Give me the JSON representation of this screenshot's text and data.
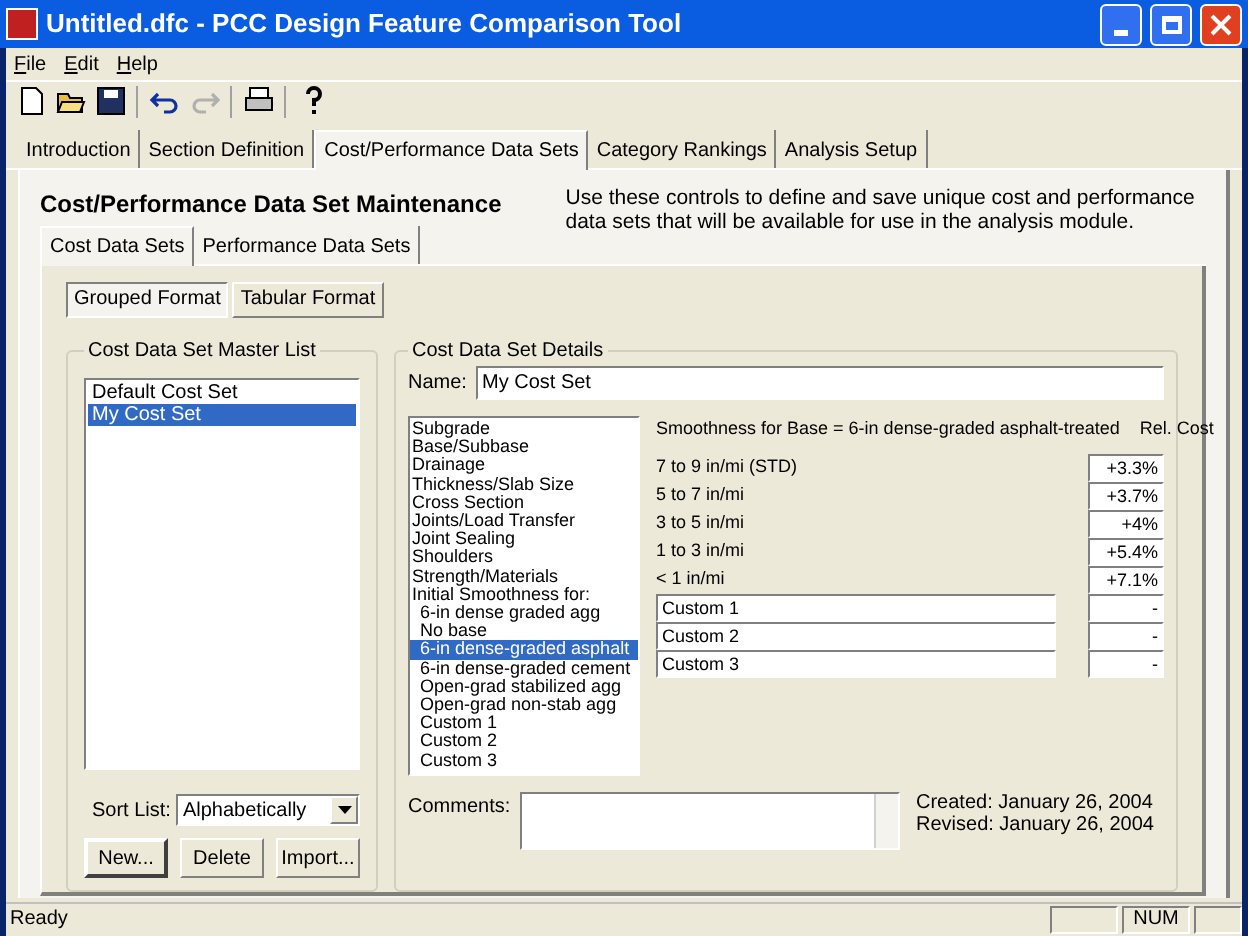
{
  "window": {
    "title": "Untitled.dfc - PCC Design Feature Comparison Tool"
  },
  "menu": [
    "File",
    "Edit",
    "Help"
  ],
  "toolbar": [
    {
      "kind": "new",
      "disabled": false
    },
    {
      "kind": "open",
      "disabled": false
    },
    {
      "kind": "save",
      "disabled": false
    },
    {
      "kind": "sep"
    },
    {
      "kind": "undo",
      "disabled": false
    },
    {
      "kind": "redo",
      "disabled": true
    },
    {
      "kind": "sep"
    },
    {
      "kind": "print",
      "disabled": false
    },
    {
      "kind": "sep"
    },
    {
      "kind": "help",
      "disabled": false
    }
  ],
  "main_tabs": [
    {
      "label": "Introduction",
      "selected": false
    },
    {
      "label": "Section Definition",
      "selected": false
    },
    {
      "label": "Cost/Performance Data Sets",
      "selected": true
    },
    {
      "label": "Category Rankings",
      "selected": false
    },
    {
      "label": "Analysis Setup",
      "selected": false
    }
  ],
  "heading": "Cost/Performance Data Set Maintenance",
  "description": "Use these controls to define and save unique cost and performance data sets that will be available for use in the analysis module.",
  "sub_tabs": [
    {
      "label": "Cost Data Sets",
      "selected": true
    },
    {
      "label": "Performance Data Sets",
      "selected": false
    }
  ],
  "format_tabs": [
    {
      "label": "Grouped Format",
      "selected": true
    },
    {
      "label": "Tabular Format",
      "selected": false
    }
  ],
  "master_list": {
    "title": "Cost Data Set Master List",
    "items": [
      {
        "label": "Default Cost Set",
        "selected": false
      },
      {
        "label": "My Cost Set",
        "selected": true
      }
    ],
    "sort_label": "Sort List:",
    "sort_value": "Alphabetically",
    "buttons": [
      {
        "label": "New...",
        "default": true
      },
      {
        "label": "Delete",
        "default": false
      },
      {
        "label": "Import...",
        "default": false
      }
    ]
  },
  "details": {
    "title": "Cost Data Set Details",
    "name_label": "Name:",
    "name_value": "My Cost Set",
    "categories": [
      {
        "label": "Subgrade",
        "selected": false
      },
      {
        "label": "Base/Subbase",
        "selected": false
      },
      {
        "label": "Drainage",
        "selected": false
      },
      {
        "label": "Thickness/Slab Size",
        "selected": false
      },
      {
        "label": "Cross Section",
        "selected": false
      },
      {
        "label": "Joints/Load Transfer",
        "selected": false
      },
      {
        "label": "Joint Sealing",
        "selected": false
      },
      {
        "label": "Shoulders",
        "selected": false
      },
      {
        "label": "Strength/Materials",
        "selected": false
      },
      {
        "label": "Initial Smoothness for:",
        "selected": false,
        "children": [
          {
            "label": "6-in dense graded agg",
            "selected": false
          },
          {
            "label": "No base",
            "selected": false
          },
          {
            "label": "6-in dense-graded asphalt",
            "selected": true
          },
          {
            "label": "6-in dense-graded cement",
            "selected": false
          },
          {
            "label": "Open-grad stabilized agg",
            "selected": false
          },
          {
            "label": "Open-grad non-stab agg",
            "selected": false
          },
          {
            "label": "Custom 1",
            "selected": false
          },
          {
            "label": "Custom 2",
            "selected": false
          },
          {
            "label": "Custom 3",
            "selected": false
          }
        ]
      }
    ],
    "table_title": "Smoothness for Base = 6-in dense-graded asphalt-treated",
    "table_cost_heading": "Rel. Cost",
    "rows": [
      {
        "kind": "fixed",
        "label": "7 to 9 in/mi (STD)",
        "cost": "+3.3%"
      },
      {
        "kind": "fixed",
        "label": "5 to 7 in/mi",
        "cost": "+3.7%"
      },
      {
        "kind": "fixed",
        "label": "3 to 5 in/mi",
        "cost": "+4%"
      },
      {
        "kind": "fixed",
        "label": "1 to 3 in/mi",
        "cost": "+5.4%"
      },
      {
        "kind": "fixed",
        "label": "< 1 in/mi",
        "cost": "+7.1%"
      },
      {
        "kind": "custom",
        "label": "Custom 1",
        "cost": "-"
      },
      {
        "kind": "custom",
        "label": "Custom 2",
        "cost": "-"
      },
      {
        "kind": "custom",
        "label": "Custom 3",
        "cost": "-"
      }
    ],
    "comments_label": "Comments:",
    "created": "Created: January 26, 2004",
    "revised": "Revised: January 26, 2004"
  },
  "status_bar": {
    "text": "Ready",
    "num": "NUM"
  }
}
